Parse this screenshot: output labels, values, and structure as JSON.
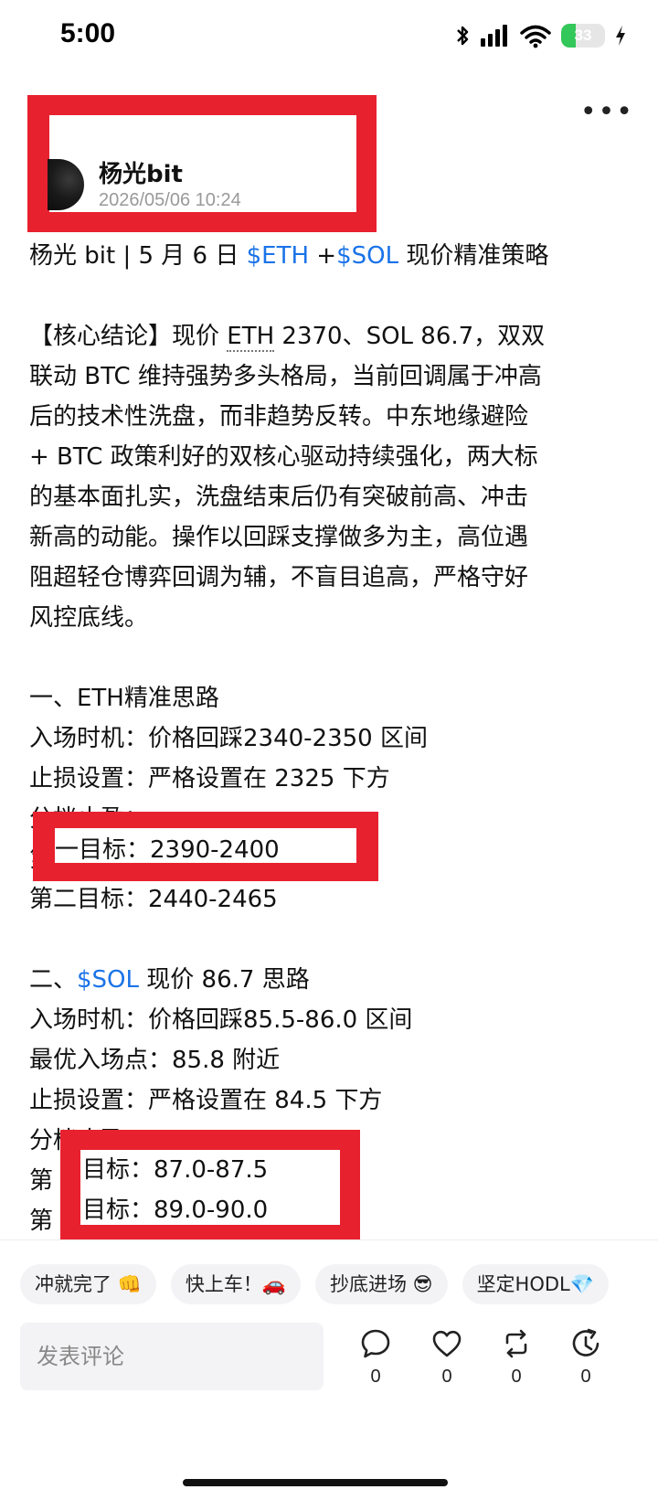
{
  "status_bar": {
    "time": "5:00",
    "battery": "33",
    "battery_level": 0.33
  },
  "author": {
    "name": "杨光bit",
    "date": "2026/05/06 10:24"
  },
  "post": {
    "title": {
      "prefix": "杨光 bit | 5 月 6 日 ",
      "tag1": "$ETH",
      "mid": " +",
      "tag2": "$SOL",
      "suffix": " 现价精准策略"
    },
    "core_lines": [
      "【核心结论】现价 ",
      "联动 BTC 维持强势多头格局，当前回调属于冲高",
      "后的技术性洗盘，而非趋势反转。中东地缘避险",
      "+ BTC 政策利好的双核心驱动持续强化，两大标",
      "的基本面扎实，洗盘结束后仍有突破前高、冲击",
      "新高的动能。操作以回踩支撑做多为主，高位遇",
      "阻超轻仓博弈回调为辅，不盲目追高，严格守好",
      "风控底线。"
    ],
    "core_eth": "ETH",
    "core_rest": " 2370、SOL 86.7，双双",
    "eth_section": {
      "heading": "一、ETH精准思路",
      "entry": "入场时机：价格回踩2340-2350 区间",
      "stop": "止损设置：严格设置在 2325 下方",
      "tp": "分档止盈：",
      "t1_prefix": "第",
      "t1_text": "一目标：2390-2400",
      "t2": "第二目标：2440-2465"
    },
    "sol_section": {
      "heading_prefix": "二、",
      "heading_tag": "$SOL",
      "heading_suffix": " 现价 86.7 思路",
      "entry": "入场时机：价格回踩85.5-86.0 区间",
      "best": "最优入场点：85.8 附近",
      "stop": "止损设置：严格设置在 84.5 下方",
      "tp": "分档止盈：",
      "t1_prefix": "第",
      "t1_text": "目标：87.0-87.5",
      "t2_prefix": "第",
      "t2_text": "目标：89.0-90.0"
    }
  },
  "chips": [
    "冲就完了 👊",
    "快上车！🚗",
    "抄底进场 😎",
    "坚定HODL💎"
  ],
  "comment": {
    "placeholder": "发表评论"
  },
  "actions": {
    "comment": "0",
    "like": "0",
    "repost": "0",
    "share": "0"
  },
  "colors": {
    "accent": "#1a73e8",
    "highlight": "#e8212f",
    "battery": "#34c759"
  }
}
